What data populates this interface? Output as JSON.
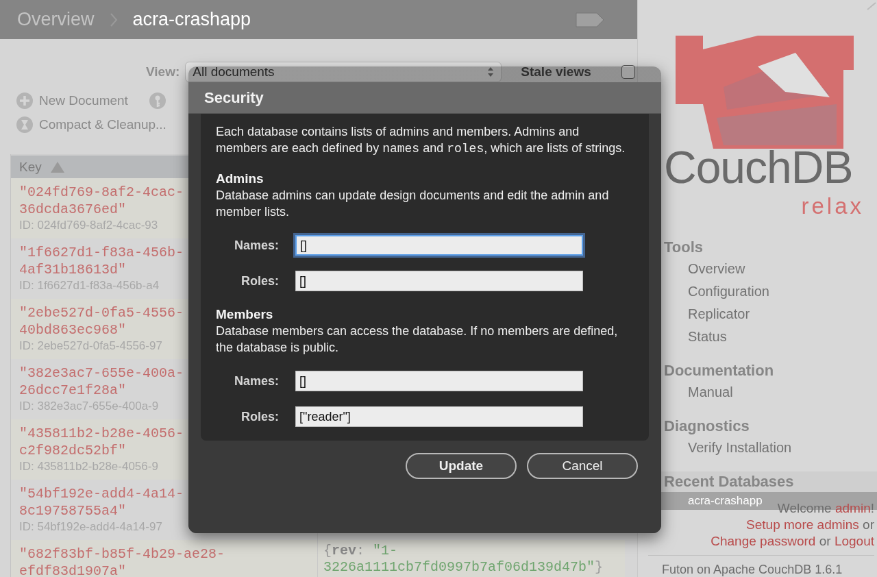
{
  "breadcrumb": [
    {
      "label": "Overview",
      "current": false
    },
    {
      "label": "acra-crashapp",
      "current": true
    }
  ],
  "toolbar": {
    "view_label": "View:",
    "view_value": "All documents",
    "stale_views": {
      "label": "Stale views",
      "checked": false
    },
    "actions": [
      {
        "kind": "plus",
        "label": "New Document"
      },
      {
        "kind": "key"
      },
      {
        "kind": "hourglass",
        "label": "Compact & Cleanup..."
      }
    ]
  },
  "table": {
    "columns": [
      "Key"
    ],
    "rows": [
      {
        "key_lines": [
          "\"024fd769-8af2-4cac-",
          "36dcda3676ed\""
        ],
        "id": "ID: 024fd769-8af2-4cac-93"
      },
      {
        "key_lines": [
          "\"1f6627d1-f83a-456b-",
          "4af31b18613d\""
        ],
        "id": "ID: 1f6627d1-f83a-456b-a4"
      },
      {
        "key_lines": [
          "\"2ebe527d-0fa5-4556-",
          "40bd863ec968\""
        ],
        "id": "ID: 2ebe527d-0fa5-4556-97"
      },
      {
        "key_lines": [
          "\"382e3ac7-655e-400a-",
          "26dcc7e1f28a\""
        ],
        "id": "ID: 382e3ac7-655e-400a-9"
      },
      {
        "key_lines": [
          "\"435811b2-b28e-4056-",
          "c2f982dc52bf\""
        ],
        "id": "ID: 435811b2-b28e-4056-9"
      },
      {
        "key_lines": [
          "\"54bf192e-add4-4a14-",
          "8c19758755a4\""
        ],
        "id": "ID: 54bf192e-add4-4a14-97"
      },
      {
        "key_lines": [
          "\"682f83bf-b85f-4b29-ae28-",
          "efdf83d1907a\""
        ],
        "value_parts": [
          {
            "kind": "punct",
            "text": "{"
          },
          {
            "kind": "field",
            "text": "rev"
          },
          {
            "kind": "punct",
            "text": ": "
          },
          {
            "kind": "string",
            "text": "\"1-3226a1111cb7fd0997b7af06d139d47b\""
          },
          {
            "kind": "punct",
            "text": "}"
          }
        ]
      }
    ]
  },
  "sidebar": {
    "logo": {
      "name": "CouchDB",
      "tagline": "relax"
    },
    "sections": [
      {
        "title": "Tools",
        "items": [
          {
            "label": "Overview",
            "selected": false
          },
          {
            "label": "Configuration",
            "selected": false
          },
          {
            "label": "Replicator",
            "selected": false
          },
          {
            "label": "Status",
            "selected": false
          }
        ]
      },
      {
        "title": "Documentation",
        "items": [
          {
            "label": "Manual",
            "selected": false
          }
        ]
      },
      {
        "title": "Diagnostics",
        "items": [
          {
            "label": "Verify Installation",
            "selected": false
          }
        ]
      },
      {
        "title": "Recent Databases",
        "items": [
          {
            "label": "acra-crashapp",
            "selected": true
          }
        ]
      }
    ],
    "footer": {
      "lines": [
        [
          {
            "kind": "text",
            "text": "Welcome "
          },
          {
            "kind": "link",
            "text": "admin"
          },
          {
            "kind": "text",
            "text": "!"
          }
        ],
        [
          {
            "kind": "link",
            "text": "Setup more admins"
          },
          {
            "kind": "text",
            "text": " or"
          }
        ],
        [
          {
            "kind": "link",
            "text": "Change password"
          },
          {
            "kind": "text",
            "text": " or "
          },
          {
            "kind": "link",
            "text": "Logout"
          }
        ]
      ],
      "version": "Futon on Apache CouchDB 1.6.1"
    }
  },
  "dialog": {
    "title": "Security",
    "intro": [
      {
        "kind": "text",
        "text": "Each database contains lists of admins and members. Admins and members are each defined by "
      },
      {
        "kind": "code",
        "text": "names"
      },
      {
        "kind": "text",
        "text": " and "
      },
      {
        "kind": "code",
        "text": "roles"
      },
      {
        "kind": "text",
        "text": ", which are lists of strings."
      }
    ],
    "sections": [
      {
        "title": "Admins",
        "description": "Database admins can update design documents and edit the admin and member lists.",
        "fields": [
          {
            "label": "Names:",
            "value": "[]",
            "focused": true
          },
          {
            "label": "Roles:",
            "value": "[]",
            "focused": false
          }
        ]
      },
      {
        "title": "Members",
        "description": "Database members can access the database. If no members are defined, the database is public.",
        "fields": [
          {
            "label": "Names:",
            "value": "[]",
            "focused": false
          },
          {
            "label": "Roles:",
            "value": "[\"reader\"]",
            "focused": false
          }
        ]
      }
    ],
    "buttons": [
      {
        "label": "Update",
        "default": true
      },
      {
        "label": "Cancel",
        "default": false
      }
    ]
  }
}
